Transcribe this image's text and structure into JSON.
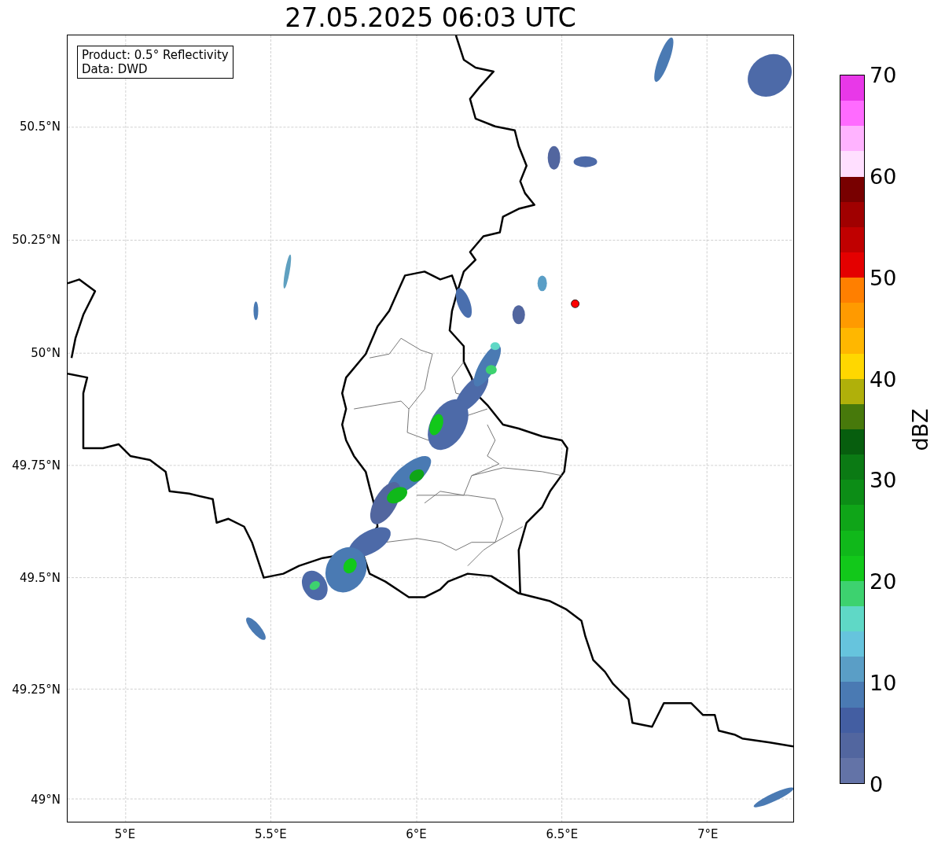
{
  "title": "27.05.2025 06:03 UTC",
  "legend": [
    "Product: 0.5° Reflectivity",
    "Data: DWD"
  ],
  "map": {
    "xticks": [
      "5°E",
      "5.5°E",
      "6°E",
      "6.5°E",
      "7°E"
    ],
    "yticks": [
      "50.5°N",
      "50.25°N",
      "50°N",
      "49.75°N",
      "49.5°N",
      "49.25°N",
      "49°N"
    ]
  },
  "colorbar": {
    "label": "dBZ",
    "ticks": [
      "70",
      "60",
      "50",
      "40",
      "30",
      "20",
      "10",
      "0"
    ],
    "bands": [
      {
        "color": "#e838e8"
      },
      {
        "color": "#ff6bff"
      },
      {
        "color": "#ffb3ff"
      },
      {
        "color": "#ffdfff"
      },
      {
        "color": "#780000"
      },
      {
        "color": "#a00000"
      },
      {
        "color": "#c00000"
      },
      {
        "color": "#e40000"
      },
      {
        "color": "#ff7f00"
      },
      {
        "color": "#ff9a00"
      },
      {
        "color": "#ffb700"
      },
      {
        "color": "#ffd700"
      },
      {
        "color": "#b0b00a"
      },
      {
        "color": "#47790b"
      },
      {
        "color": "#075e0e"
      },
      {
        "color": "#0b7a14"
      },
      {
        "color": "#0c8d16"
      },
      {
        "color": "#0fa518"
      },
      {
        "color": "#10b81a"
      },
      {
        "color": "#12c81a"
      },
      {
        "color": "#3dd26f"
      },
      {
        "color": "#5fd8c6"
      },
      {
        "color": "#66c4dd"
      },
      {
        "color": "#5a9ec6"
      },
      {
        "color": "#4a7ab3"
      },
      {
        "color": "#435ea2"
      },
      {
        "color": "#52669f"
      },
      {
        "color": "#6373a7"
      }
    ]
  }
}
